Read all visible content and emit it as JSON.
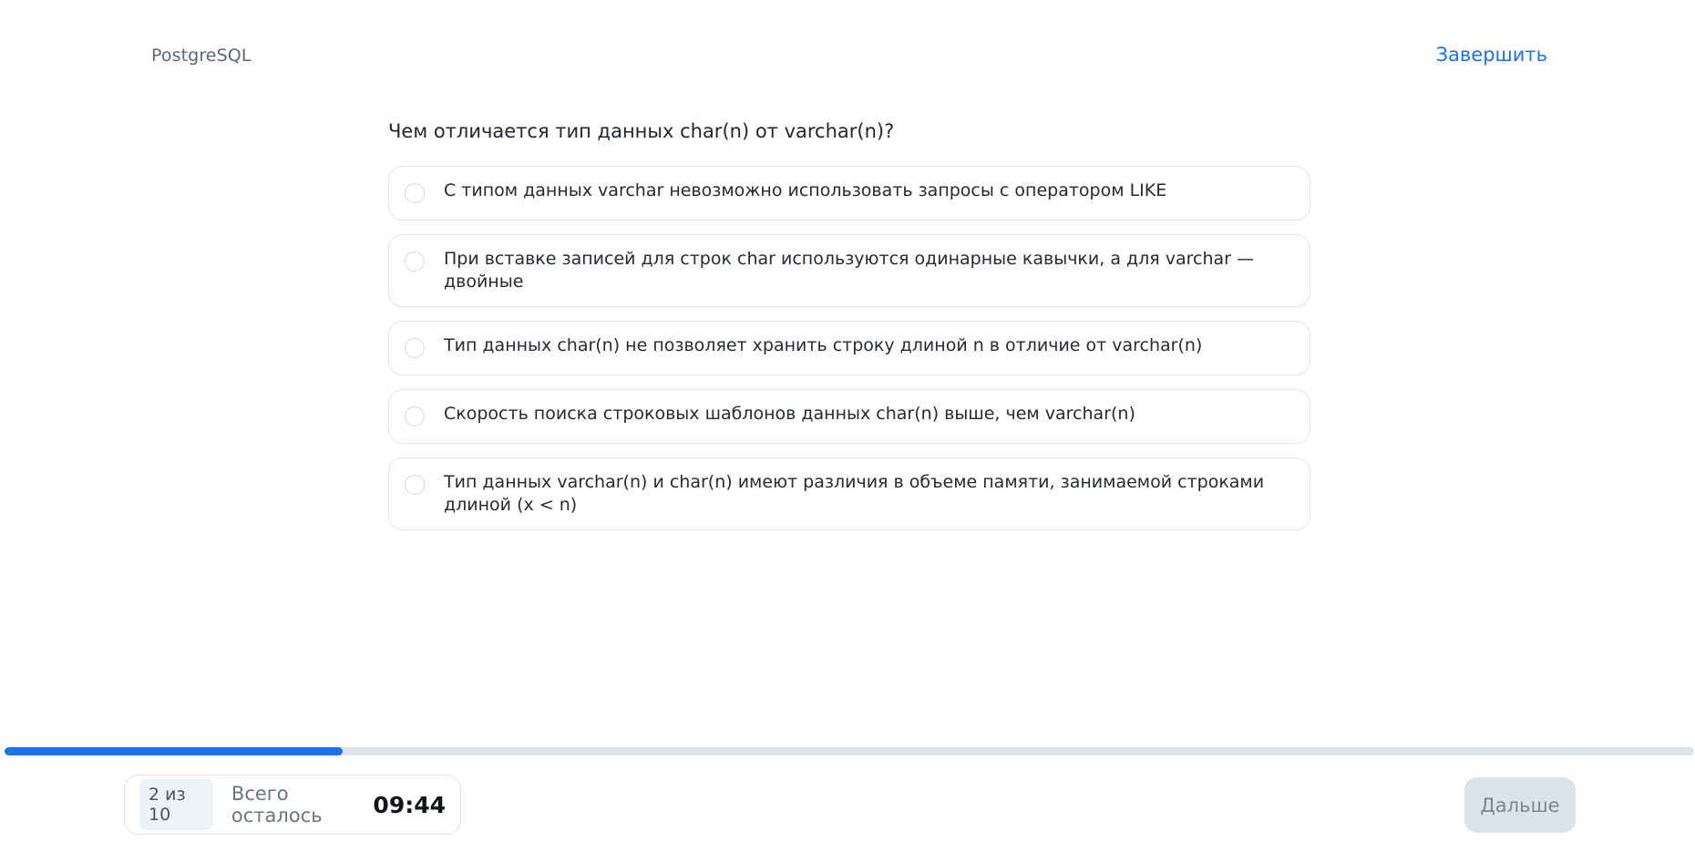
{
  "header": {
    "course_title": "PostgreSQL",
    "finish_label": "Завершить"
  },
  "quiz": {
    "question": "Чем отличается тип данных char(n) от varchar(n)?",
    "options": [
      {
        "label": "С типом данных varchar невозможно использовать запросы с оператором LIKE",
        "selected": false
      },
      {
        "label": "При вставке записей для строк char используются одинарные кавычки, а для varchar — двойные",
        "selected": false
      },
      {
        "label": "Тип данных char(n) не позволяет хранить строку длиной n в отличие от varchar(n)",
        "selected": false
      },
      {
        "label": "Скорость поиска строковых шаблонов данных char(n) выше, чем varchar(n)",
        "selected": false
      },
      {
        "label": "Тип данных varchar(n) и char(n) имеют различия в объеме памяти, занимаемой строками длиной (x < n)",
        "selected": false
      }
    ]
  },
  "progress": {
    "fraction": 0.2,
    "counter": "2 из 10"
  },
  "footer": {
    "remaining_label": "Всего осталось",
    "timer": "09:44",
    "next_label": "Дальше"
  },
  "colors": {
    "accent": "#1a73e8",
    "track": "#dde3ea",
    "disabled_button_text": "#7d8794"
  }
}
